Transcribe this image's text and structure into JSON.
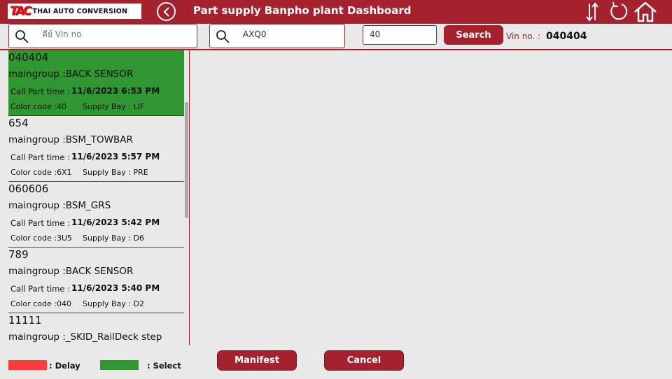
{
  "header": {
    "logo_mark": "TAC",
    "logo_text": "THAI AUTO CONVERSION",
    "title": "Part supply Banpho plant Dashboard",
    "icons": [
      "back-icon",
      "sort-icon",
      "refresh-icon",
      "home-icon"
    ]
  },
  "search": {
    "vin_placeholder": "คีย์ Vin no",
    "vin_value": "",
    "code_value": "AXQ0",
    "qty_value": "40",
    "search_label": "Search",
    "vin_label": "Vin no. :",
    "vin_selected": "040404"
  },
  "items": [
    {
      "vin": "040404",
      "group": "maingroup :BACK SENSOR",
      "time_label": "Call Part time :",
      "time": "11/6/2023 6:53 PM",
      "color": "Color code :40",
      "bay": "Supply Bay : LIF",
      "selected": true
    },
    {
      "vin": "654",
      "group": "maingroup :BSM_TOWBAR",
      "time_label": "Call Part time :",
      "time": "11/6/2023 5:57 PM",
      "color": "Color code :6X1",
      "bay": "Supply Bay : PRE",
      "selected": false
    },
    {
      "vin": "060606",
      "group": "maingroup :BSM_GRS",
      "time_label": "Call Part time :",
      "time": "11/6/2023 5:42 PM",
      "color": "Color code :3U5",
      "bay": "Supply Bay : D6",
      "selected": false
    },
    {
      "vin": "789",
      "group": "maingroup :BACK SENSOR",
      "time_label": "Call Part time :",
      "time": "11/6/2023 5:40 PM",
      "color": "Color code :040",
      "bay": "Supply Bay : D2",
      "selected": false
    },
    {
      "vin": "11111",
      "group": "maingroup :_SKID_RailDeck step",
      "time_label": "",
      "time": "",
      "color": "",
      "bay": "",
      "selected": false
    }
  ],
  "legend": {
    "delay_label": ": Delay",
    "delay_color": "#ff3b3b",
    "select_label": ": Select",
    "select_color": "#2f9631"
  },
  "actions": {
    "manifest_label": "Manifest",
    "cancel_label": "Cancel"
  },
  "colors": {
    "brand": "#a5212e",
    "background": "#e9e9e9"
  }
}
